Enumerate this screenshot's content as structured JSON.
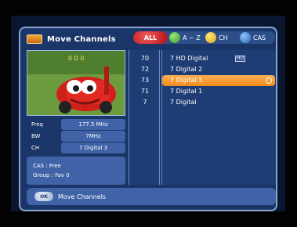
{
  "header": {
    "title": "Move Channels",
    "sort": {
      "all": "ALL",
      "az": "A ~ Z",
      "ch": "CH",
      "cas": "CAS"
    }
  },
  "info": {
    "freq_label": "Freq",
    "freq_value": "177.5 MHz",
    "bw_label": "BW",
    "bw_value": "7MHz",
    "ch_label": "CH",
    "ch_value": "7 Digital 3",
    "cas": "CAS : Free",
    "group": "Group : Fav 0"
  },
  "channels": [
    {
      "num": "70",
      "name": "7 HD Digital",
      "hd": "HD"
    },
    {
      "num": "72",
      "name": "7 Digital 2"
    },
    {
      "num": "73",
      "name": "7 Digital 3",
      "selected": true
    },
    {
      "num": "71",
      "name": "7 Digital 1"
    },
    {
      "num": "7",
      "name": "7 Digital"
    }
  ],
  "footer": {
    "ok": "OK",
    "label": "Move Channels"
  },
  "colors": {
    "panel": "#1a3568",
    "accent_orange": "#f18a1a",
    "red": "#b10f14",
    "green": "#3a9a26",
    "yellow": "#e2a414",
    "blue": "#2e6cc2"
  }
}
